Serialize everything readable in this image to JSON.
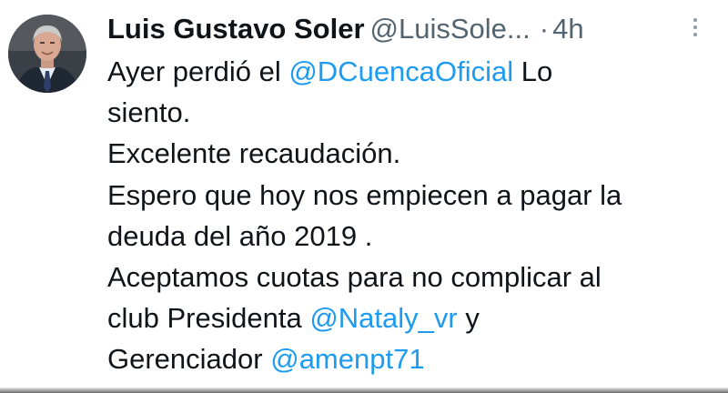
{
  "author": {
    "name": "Luis Gustavo Soler",
    "handle": "@LuisSole...",
    "separator": "·",
    "time": "4h"
  },
  "tweet": {
    "line1_prefix": "Ayer perdió el ",
    "line1_mention": "@DCuencaOficial",
    "line1_suffix": " Lo",
    "line2": "siento.",
    "line3": "Excelente recaudación.",
    "line4": "Espero que hoy nos empiecen a pagar la",
    "line5": "deuda del año 2019 .",
    "line6": "Aceptamos cuotas para no complicar al",
    "line7_prefix": "club Presidenta ",
    "line7_mention": "@Nataly_vr",
    "line7_suffix": " y",
    "line8_prefix": "Gerenciador ",
    "line8_mention": "@amenpt71"
  },
  "icons": {
    "more": "more-vertical-icon",
    "avatar": "avatar"
  },
  "colors": {
    "text": "#0f1419",
    "secondary": "#536471",
    "mention": "#1d9bf0",
    "background": "#ffffff"
  }
}
